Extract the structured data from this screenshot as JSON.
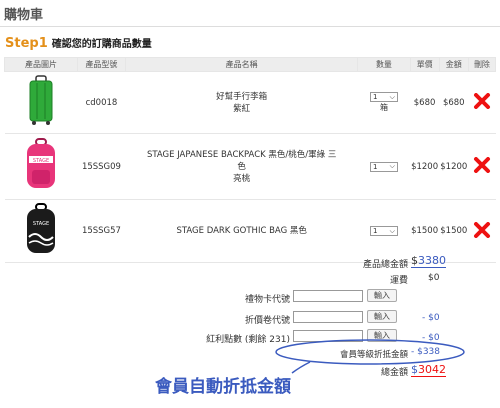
{
  "page": {
    "title": "購物車"
  },
  "step": {
    "label": "Step1",
    "text": "確認您的訂購商品數量"
  },
  "table": {
    "headers": [
      "產品圖片",
      "產品型號",
      "產品名稱",
      "數量",
      "單價",
      "金額",
      "刪除"
    ],
    "rows": [
      {
        "model": "cd0018",
        "name_line1": "好幫手行李箱",
        "name_line2": "紫紅",
        "name_line3": "",
        "qty": "1",
        "unit": "箱",
        "price": "$680",
        "amount": "$680",
        "image_color": "#2faa3a"
      },
      {
        "model": "15SSG09",
        "name_line1": "STAGE JAPANESE BACKPACK 黑色/桃色/軍綠 三",
        "name_line2": "色",
        "name_line3": "亮桃",
        "qty": "1",
        "unit": "",
        "price": "$1200",
        "amount": "$1200",
        "image_color": "#e8357a"
      },
      {
        "model": "15SSG57",
        "name_line1": "STAGE DARK GOTHIC BAG 黑色",
        "name_line2": "",
        "name_line3": "",
        "qty": "1",
        "unit": "",
        "price": "$1500",
        "amount": "$1500",
        "image_color": "#1b1b1b"
      }
    ]
  },
  "summary": {
    "subtotal_label": "產品總金額",
    "subtotal_currency": "$",
    "subtotal_value": "3380",
    "shipping_label": "運費",
    "shipping_value": "$0",
    "gift_label": "禮物卡代號",
    "gift_btn": "輸入",
    "coupon_label": "折價卷代號",
    "coupon_btn": "輸入",
    "coupon_value": "- $0",
    "points_label": "紅利點數 (剩餘 231)",
    "points_btn": "輸入",
    "points_value": "- $0",
    "member_label": "會員等級折抵金額",
    "member_value": "- $338",
    "total_label": "總金額",
    "total_currency": "$",
    "total_value": "3042"
  },
  "annotation": "會員自動折抵金額",
  "colors": {
    "accent": "#e4901a",
    "link": "#3b5bbf",
    "delete": "#e11",
    "total": "#e11"
  }
}
